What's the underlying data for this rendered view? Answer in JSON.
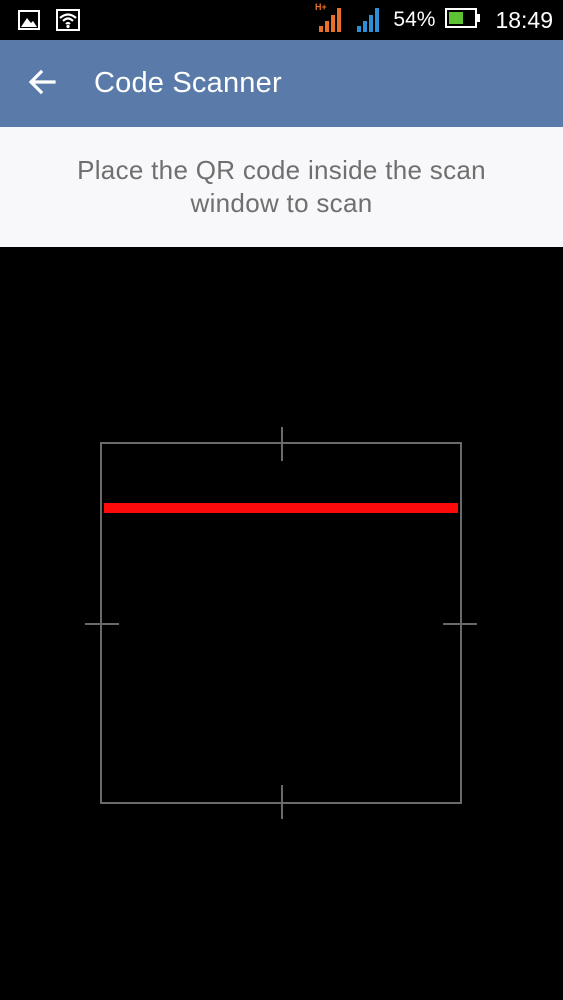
{
  "status_bar": {
    "network_type": "H+",
    "battery_percent": "54%",
    "battery_level": 0.54,
    "time": "18:49",
    "icons": [
      "gallery-icon",
      "wifi-icon",
      "signal-icon-sim1",
      "signal-icon-sim2",
      "battery-icon"
    ],
    "colors": {
      "signal_sim1": "#e8702a",
      "signal_sim2": "#2f8fd6",
      "battery": "#5cc234"
    }
  },
  "app_bar": {
    "title": "Code Scanner",
    "back_icon": "arrow-left-icon",
    "background": "#5a7ba9"
  },
  "instruction": {
    "text": "Place the QR code inside the scan window to scan"
  },
  "scanner": {
    "laser_color": "#ff0a0a",
    "frame_color": "#6a6a6a"
  }
}
